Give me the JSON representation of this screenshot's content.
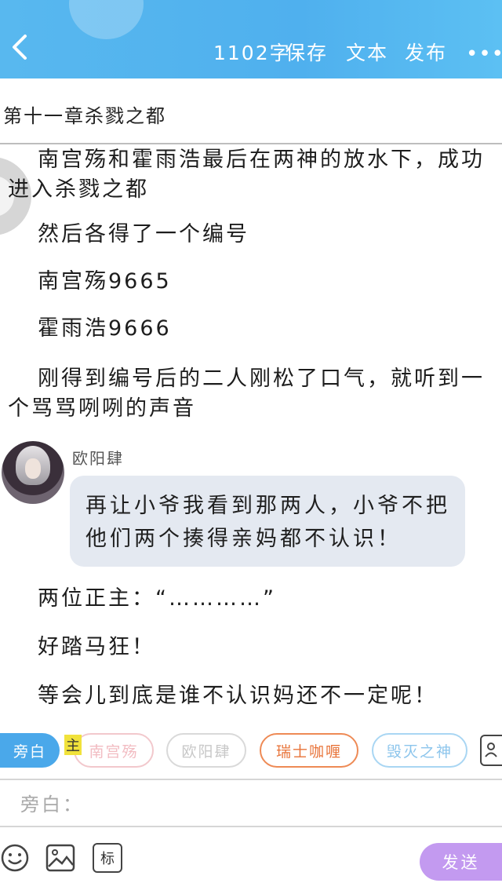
{
  "header": {
    "word_count": "1102字",
    "save_label": "保存",
    "text_label": "文本",
    "publish_label": "发布",
    "more_icon": "more-icon",
    "back_icon": "back-arrow-icon",
    "color": "#58b8ef"
  },
  "chapter": {
    "title": "第十一章杀戮之都"
  },
  "paragraphs": [
    "南宫殇和霍雨浩最后在两神的放水下，成功进入杀戮之都",
    "然后各得了一个编号",
    "南宫殇9665",
    "霍雨浩9666",
    "刚得到编号后的二人刚松了口气，就听到一个骂骂咧咧的声音"
  ],
  "dialogue": {
    "speaker": "欧阳肆",
    "text": "再让小爷我看到那两人，小爷不把他们两个揍得亲妈都不认识！"
  },
  "after": [
    "两位正主：“…………”",
    "好踏马狂！",
    "等会儿到底是谁不认识妈还不一定呢！"
  ],
  "roles": {
    "active": "旁白",
    "main_tag": "主",
    "chips": [
      "南宫殇",
      "欧阳肆",
      "瑞士咖喱",
      "毁灭之神"
    ]
  },
  "input": {
    "placeholder": "旁白："
  },
  "toolbar": {
    "emoji_icon": "emoji-icon",
    "image_icon": "image-icon",
    "tag_label": "标",
    "send_label": "发送",
    "send_color": "#c39af0"
  }
}
